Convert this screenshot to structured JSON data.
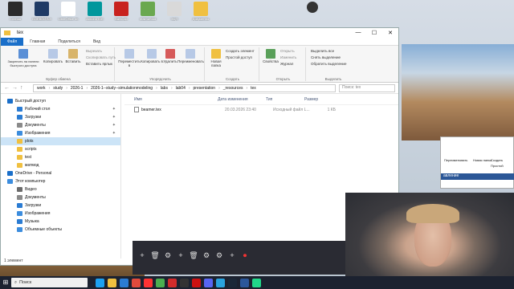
{
  "desktop": {
    "icons": [
      {
        "label": "Слепая",
        "color": "#2b2b2b"
      },
      {
        "label": "БОЕВОЙ БЭ",
        "color": "#1f3b66"
      },
      {
        "label": "LibreOffice Im",
        "color": "#ffffff"
      },
      {
        "label": "Arduino IDE",
        "color": "#00979c"
      },
      {
        "label": "BarsCap",
        "color": "#c8221e"
      },
      {
        "label": "realmaStud",
        "color": "#6aa84f"
      },
      {
        "label": "ЭЦП",
        "color": "#d9d9d9"
      },
      {
        "label": "Документы",
        "color": "#f0c040"
      }
    ],
    "right_icon": {
      "label": "",
      "color": "#333333"
    }
  },
  "explorer": {
    "title": "tex",
    "controls": {
      "minimize": "—",
      "maximize": "☐",
      "close": "✕"
    },
    "tabs": [
      "Файл",
      "Главная",
      "Поделиться",
      "Вид"
    ],
    "ribbon": {
      "clipboard": {
        "pin_label": "Закрепить на панели быстрого доступа",
        "copy_label": "Копировать",
        "paste_label": "Вставить",
        "cut": "Вырезать",
        "copy_path": "Скопировать путь",
        "paste_shortcut": "Вставить ярлык",
        "group": "Буфер обмена"
      },
      "organize": {
        "move": "Переместить в",
        "copy": "Копировать в",
        "delete": "Удалить",
        "rename": "Переименовать",
        "group": "Упорядочить"
      },
      "create": {
        "new_folder": "Новая папка",
        "new_item": "Создать элемент",
        "easy_access": "Простой доступ",
        "group": "Создать"
      },
      "open": {
        "properties": "Свойства",
        "open": "Открыть",
        "edit": "Изменить",
        "history": "Журнал",
        "group": "Открыть"
      },
      "select": {
        "select_all": "Выделить все",
        "select_none": "Снять выделение",
        "invert": "Обратить выделение",
        "group": "Выделить"
      }
    },
    "address": {
      "back": "←",
      "forward": "→",
      "up": "↑",
      "crumbs": [
        "work",
        "study",
        "2026-1",
        "2026-1--study--simulationmodeling",
        "labs",
        "lab04",
        "presentation",
        "_resources",
        "tex"
      ],
      "search_placeholder": "Поиск: tex"
    },
    "nav": [
      {
        "label": "Быстрый доступ",
        "level": 0,
        "color": "#1a6fc9",
        "pinned": false,
        "selected": false
      },
      {
        "label": "Рабочий стол",
        "level": 1,
        "color": "#2b7cd3",
        "pinned": true,
        "selected": false
      },
      {
        "label": "Загрузки",
        "level": 1,
        "color": "#2b7cd3",
        "pinned": true,
        "selected": false
      },
      {
        "label": "Документы",
        "level": 1,
        "color": "#8a8a8a",
        "pinned": true,
        "selected": false
      },
      {
        "label": "Изображения",
        "level": 1,
        "color": "#3c8dde",
        "pinned": true,
        "selected": false
      },
      {
        "label": "plots",
        "level": 1,
        "color": "#f0c040",
        "pinned": false,
        "selected": true
      },
      {
        "label": "scripts",
        "level": 1,
        "color": "#f0c040",
        "pinned": false,
        "selected": false
      },
      {
        "label": "test",
        "level": 1,
        "color": "#f0c040",
        "pinned": false,
        "selected": false
      },
      {
        "label": "матмод",
        "level": 1,
        "color": "#f0c040",
        "pinned": false,
        "selected": false
      },
      {
        "label": "OneDrive - Personal",
        "level": 0,
        "color": "#1a6fc9",
        "pinned": false,
        "selected": false
      },
      {
        "label": "Этот компьютер",
        "level": 0,
        "color": "#3c8dde",
        "pinned": false,
        "selected": false
      },
      {
        "label": "Видео",
        "level": 1,
        "color": "#6b6b6b",
        "pinned": false,
        "selected": false
      },
      {
        "label": "Документы",
        "level": 1,
        "color": "#8a8a8a",
        "pinned": false,
        "selected": false
      },
      {
        "label": "Загрузки",
        "level": 1,
        "color": "#2b7cd3",
        "pinned": false,
        "selected": false
      },
      {
        "label": "Изображения",
        "level": 1,
        "color": "#3c8dde",
        "pinned": false,
        "selected": false
      },
      {
        "label": "Музыка",
        "level": 1,
        "color": "#2b7cd3",
        "pinned": false,
        "selected": false
      },
      {
        "label": "Объемные объекты",
        "level": 1,
        "color": "#3c8dde",
        "pinned": false,
        "selected": false
      }
    ],
    "columns": {
      "name": "Имя",
      "date": "Дата изменения",
      "type": "Тип",
      "size": "Размер"
    },
    "files": [
      {
        "name": "beamer.tex",
        "date": "20.03.2026 23:40",
        "type": "Исходный файл L...",
        "size": "1 КБ"
      }
    ],
    "status": "1 элемент"
  },
  "second_window": {
    "header_text": "авление",
    "buttons": [
      "Переименовать",
      "Новая папка"
    ],
    "small": [
      "Создать",
      "Простой"
    ]
  },
  "dock": {
    "buttons": [
      "+",
      "🗑",
      "⚙",
      "+",
      "🗑",
      "⚙",
      "⚙",
      "+",
      "⏺"
    ]
  },
  "taskbar": {
    "search_placeholder": "Поиск",
    "apps": [
      {
        "name": "edge",
        "color": "#1da1f2"
      },
      {
        "name": "explorer",
        "color": "#f0c040"
      },
      {
        "name": "mail",
        "color": "#2b7cd3"
      },
      {
        "name": "chrome",
        "color": "#e04a3c"
      },
      {
        "name": "yandex",
        "color": "#ff3333"
      },
      {
        "name": "minecraft",
        "color": "#4caf50"
      },
      {
        "name": "opera",
        "color": "#d12b2b"
      },
      {
        "name": "obs",
        "color": "#333333"
      },
      {
        "name": "acrobat",
        "color": "#c11"
      },
      {
        "name": "discord",
        "color": "#5865f2"
      },
      {
        "name": "telegram",
        "color": "#2aa3de"
      },
      {
        "name": "steam",
        "color": "#1b2838"
      },
      {
        "name": "word",
        "color": "#2b579a"
      },
      {
        "name": "pycharm",
        "color": "#21d789"
      }
    ]
  }
}
